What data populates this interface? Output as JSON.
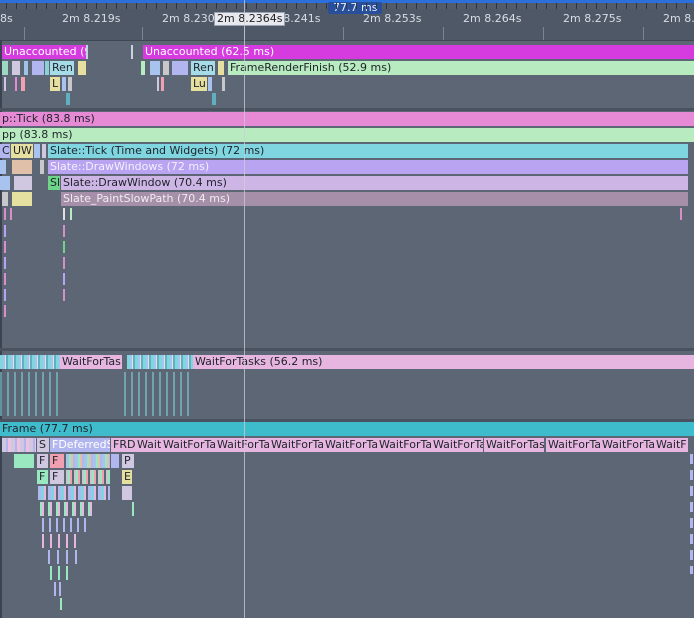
{
  "ruler": {
    "selection_duration": "77.7 ms",
    "cursor_time": "2m 8.2364s",
    "labels": [
      "8s",
      "2m 8.219s",
      "2m 8.230s",
      "2m 8.241s",
      "2m 8.253s",
      "2m 8.264s",
      "2m 8.275s",
      "2m 8.28"
    ]
  },
  "track1": {
    "unaccounted_left": "Unaccounted (9.",
    "unaccounted_right": "Unaccounted (62.5 ms)",
    "ren_left": "Ren",
    "ren_right": "Ren",
    "frame_render_finish": "FrameRenderFinish (52.9 ms)",
    "l_left": "L",
    "lu": "Lu"
  },
  "track2": {
    "tick": "p::Tick (83.8 ms)",
    "app": "pp (83.8 ms)",
    "c_short": "C",
    "uw": "UW",
    "slate_tick": "Slate::Tick (Time and Widgets) (72 ms)",
    "slate_drawwindows": "Slate::DrawWindows (72 ms)",
    "sl": "Sl",
    "slate_drawwindow": "Slate::DrawWindow (70.4 ms)",
    "slate_paintslowpath": "Slate_PaintSlowPath (70.4 ms)"
  },
  "track3": {
    "wait_short": "WaitForTas",
    "wait_long": "WaitForTasks (56.2 ms)"
  },
  "track4": {
    "frame": "Frame (77.7 ms)",
    "s": "S",
    "fdeferred": "FDeferredS",
    "frd": "FRD",
    "wait_labels": [
      "Wait",
      "WaitForTa",
      "WaitForTa",
      "WaitForTa",
      "WaitForTa",
      "WaitForTa",
      "WaitForTa"
    ],
    "wait_tas": "WaitForTas",
    "wait_labels2": [
      "WaitForTa",
      "WaitForTa",
      "WaitF"
    ],
    "f1": "F",
    "f2": "F",
    "p": "P",
    "f3": "F",
    "f4": "F",
    "e": "E"
  },
  "colors": {
    "magenta": "#d63be0",
    "green_light": "#b8ecc0",
    "pink": "#e68ad6",
    "cyan": "#7fd6e0",
    "lavender": "#b9a4f2",
    "lilac": "#cdb6e6",
    "mauve": "#a68fa8",
    "teal": "#3fbccc",
    "yellow": "#e6e0a0"
  }
}
